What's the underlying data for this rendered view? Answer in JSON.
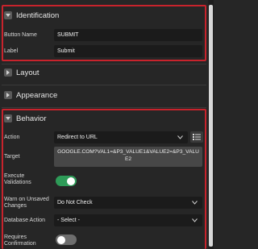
{
  "sections": {
    "identification": "Identification",
    "layout": "Layout",
    "appearance": "Appearance",
    "behavior": "Behavior"
  },
  "identification": {
    "button_name_label": "Button Name",
    "button_name_value": "SUBMIT",
    "label_label": "Label",
    "label_value": "Submit"
  },
  "behavior": {
    "action_label": "Action",
    "action_value": "Redirect to URL",
    "target_label": "Target",
    "target_value": "GOOGLE.COM?VAL1=&P3_VALUE1&VALUE2=&P3_VALUE2",
    "execute_validations_label": "Execute Validations",
    "execute_validations_on": true,
    "warn_unsaved_label": "Warn on Unsaved Changes",
    "warn_unsaved_value": "Do Not Check",
    "database_action_label": "Database Action",
    "database_action_value": "- Select -",
    "requires_confirmation_label": "Requires Confirmation",
    "requires_confirmation_on": false
  },
  "colors": {
    "highlight": "#c8232c",
    "toggle_on": "#2e9b58",
    "toggle_off": "#6e6e6e"
  }
}
